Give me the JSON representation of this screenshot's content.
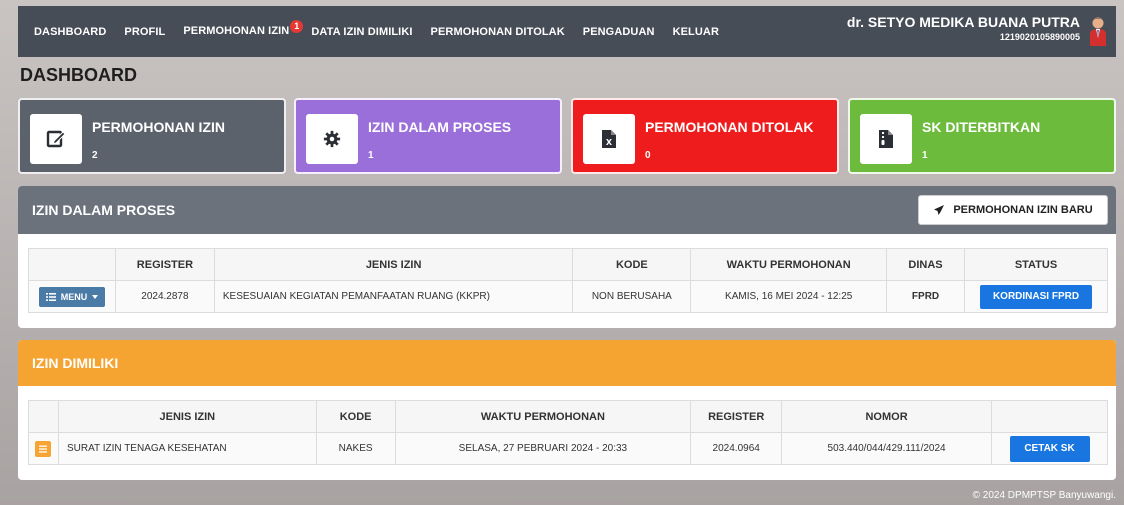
{
  "nav": {
    "items": [
      "DASHBOARD",
      "PROFIL",
      "PERMOHONAN IZIN",
      "DATA IZIN DIMILIKI",
      "PERMOHONAN DITOLAK",
      "PENGADUAN",
      "KELUAR"
    ],
    "badge": "1"
  },
  "user": {
    "name": "dr. SETYO MEDIKA BUANA PUTRA",
    "id": "1219020105890005"
  },
  "page_title": "DASHBOARD",
  "cards": [
    {
      "title": "PERMOHONAN IZIN",
      "count": "2",
      "icon": "edit-icon",
      "color": "#5c626b"
    },
    {
      "title": "IZIN DALAM PROSES",
      "count": "1",
      "icon": "gear-icon",
      "color": "#9b6fd9"
    },
    {
      "title": "PERMOHONAN DITOLAK",
      "count": "0",
      "icon": "file-excel-icon",
      "color": "#ee1c1c"
    },
    {
      "title": "SK DITERBITKAN",
      "count": "1",
      "icon": "file-zip-icon",
      "color": "#6cbb3c"
    }
  ],
  "proses": {
    "title": "IZIN DALAM PROSES",
    "new_button": "PERMOHONAN IZIN BARU",
    "headers": [
      "",
      "REGISTER",
      "JENIS IZIN",
      "KODE",
      "WAKTU PERMOHONAN",
      "DINAS",
      "STATUS"
    ],
    "row": {
      "menu": "MENU",
      "register": "2024.2878",
      "jenis": "KESESUAIAN KEGIATAN PEMANFAATAN RUANG (KKPR)",
      "kode": "NON BERUSAHA",
      "waktu": "KAMIS, 16 MEI 2024 - 12:25",
      "dinas": "FPRD",
      "status": "KORDINASI FPRD"
    }
  },
  "dimiliki": {
    "title": "IZIN DIMILIKI",
    "headers": [
      "",
      "JENIS IZIN",
      "KODE",
      "WAKTU PERMOHONAN",
      "REGISTER",
      "NOMOR",
      ""
    ],
    "row": {
      "jenis": "SURAT IZIN TENAGA KESEHATAN",
      "kode": "NAKES",
      "waktu": "SELASA, 27 PEBRUARI 2024 - 20:33",
      "register": "2024.0964",
      "nomor": "503.440/044/429.111/2024",
      "action": "CETAK SK"
    }
  },
  "footer": "© 2024 DPMPTSP Banyuwangi.",
  "colors": {
    "nav": "#474d56",
    "proses_head": "#6b727c",
    "dimiliki_head": "#f6a431",
    "blue": "#1976e0"
  }
}
